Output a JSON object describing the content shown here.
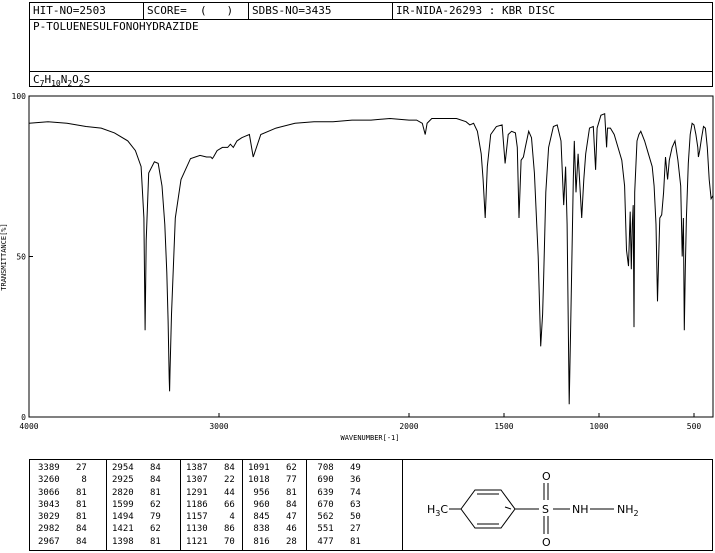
{
  "header": {
    "hit_no": "HIT-NO=2503",
    "score": "SCORE=  (   )",
    "sdbs_no": "SDBS-NO=3435",
    "ir_info": "IR-NIDA-26293 : KBR DISC",
    "compound_name": "P-TOLUENESULFONOHYDRAZIDE",
    "formula": {
      "C": "7",
      "H": "10",
      "N": "2",
      "O": "2",
      "S": ""
    }
  },
  "chart_data": {
    "type": "line",
    "xlabel": "WAVENUMBER[-1]",
    "ylabel": "TRANSMITTANCE[%]",
    "xlim": [
      4000,
      400
    ],
    "ylim": [
      0,
      100
    ],
    "x_ticks": [
      4000,
      3000,
      2000,
      1500,
      1000,
      500
    ],
    "y_ticks": [
      0,
      50,
      100
    ],
    "series": [
      {
        "x": [
          4000,
          3900,
          3800,
          3750,
          3700,
          3620,
          3550,
          3480,
          3440,
          3410,
          3395,
          3389,
          3383,
          3370,
          3340,
          3320,
          3300,
          3285,
          3275,
          3268,
          3262,
          3260,
          3258,
          3250,
          3230,
          3200,
          3150,
          3100,
          3066,
          3043,
          3035,
          3029,
          3010,
          2982,
          2967,
          2954,
          2940,
          2925,
          2905,
          2880,
          2860,
          2840,
          2820,
          2780,
          2700,
          2600,
          2500,
          2400,
          2300,
          2200,
          2100,
          2000,
          1960,
          1930,
          1915,
          1905,
          1880,
          1840,
          1800,
          1750,
          1700,
          1680,
          1660,
          1640,
          1620,
          1610,
          1599,
          1588,
          1570,
          1540,
          1510,
          1494,
          1478,
          1460,
          1440,
          1430,
          1421,
          1410,
          1398,
          1388,
          1370,
          1355,
          1340,
          1320,
          1307,
          1297,
          1291,
          1280,
          1265,
          1240,
          1220,
          1200,
          1186,
          1176,
          1168,
          1157,
          1148,
          1135,
          1130,
          1121,
          1110,
          1091,
          1080,
          1070,
          1050,
          1030,
          1018,
          1010,
          990,
          970,
          960,
          955,
          940,
          920,
          900,
          880,
          865,
          855,
          845,
          836,
          830,
          825,
          820,
          816,
          812,
          800,
          790,
          780,
          760,
          740,
          720,
          710,
          700,
          692,
          686,
          680,
          670,
          660,
          650,
          639,
          630,
          615,
          600,
          585,
          570,
          562,
          556,
          551,
          546,
          540,
          530,
          520,
          510,
          500,
          490,
          480,
          477,
          470,
          460,
          450,
          440,
          430,
          420,
          410,
          400
        ],
        "y": [
          91.5,
          92.0,
          91.5,
          91.0,
          90.5,
          90.0,
          88.5,
          86.0,
          83.0,
          78.0,
          62.0,
          27.0,
          55.0,
          76.0,
          79.5,
          79.0,
          72.0,
          60.0,
          45.0,
          30.0,
          12.0,
          8.0,
          14.0,
          32.0,
          62.0,
          74.0,
          80.5,
          81.5,
          81.0,
          81.0,
          80.5,
          81.0,
          83.0,
          84.0,
          84.0,
          84.0,
          85.0,
          84.0,
          86.0,
          87.0,
          87.5,
          88.0,
          81.0,
          88.0,
          90.0,
          91.5,
          92.0,
          92.0,
          92.5,
          92.5,
          93.0,
          92.5,
          92.5,
          91.5,
          88.0,
          91.5,
          93.0,
          93.0,
          93.0,
          93.0,
          92.0,
          91.0,
          91.5,
          89.0,
          82.0,
          74.0,
          62.0,
          78.0,
          88.0,
          90.5,
          91.0,
          79.0,
          88.0,
          89.0,
          88.5,
          84.0,
          62.0,
          80.0,
          81.0,
          84.0,
          89.0,
          87.0,
          76.0,
          50.0,
          22.0,
          32.0,
          44.0,
          70.0,
          84.0,
          90.5,
          91.0,
          86.0,
          66.0,
          78.0,
          60.0,
          4.0,
          32.0,
          74.0,
          86.0,
          70.0,
          82.0,
          62.0,
          74.0,
          82.0,
          90.0,
          90.5,
          77.0,
          90.0,
          94.0,
          94.5,
          84.0,
          90.0,
          90.0,
          88.0,
          84.0,
          80.0,
          72.0,
          52.0,
          47.0,
          64.0,
          46.0,
          60.0,
          66.0,
          28.0,
          70.0,
          86.0,
          88.0,
          89.0,
          86.0,
          82.0,
          78.0,
          72.0,
          60.0,
          36.0,
          50.0,
          62.0,
          63.0,
          70.0,
          81.0,
          74.0,
          80.0,
          84.0,
          86.0,
          80.0,
          72.0,
          50.0,
          62.0,
          27.0,
          46.0,
          62.0,
          79.0,
          88.0,
          91.5,
          91.0,
          88.0,
          84.0,
          81.0,
          83.0,
          87.0,
          90.5,
          90.0,
          84.0,
          74.0,
          68.0,
          69.0
        ]
      }
    ]
  },
  "peaks": [
    {
      "wn": "3389",
      "t": "27"
    },
    {
      "wn": "3260",
      "t": "8"
    },
    {
      "wn": "3066",
      "t": "81"
    },
    {
      "wn": "3043",
      "t": "81"
    },
    {
      "wn": "3029",
      "t": "81"
    },
    {
      "wn": "2982",
      "t": "84"
    },
    {
      "wn": "2967",
      "t": "84"
    },
    {
      "wn": "2954",
      "t": "84"
    },
    {
      "wn": "2925",
      "t": "84"
    },
    {
      "wn": "2820",
      "t": "81"
    },
    {
      "wn": "1599",
      "t": "62"
    },
    {
      "wn": "1494",
      "t": "79"
    },
    {
      "wn": "1421",
      "t": "62"
    },
    {
      "wn": "1398",
      "t": "81"
    },
    {
      "wn": "1387",
      "t": "84"
    },
    {
      "wn": "1307",
      "t": "22"
    },
    {
      "wn": "1291",
      "t": "44"
    },
    {
      "wn": "1186",
      "t": "66"
    },
    {
      "wn": "1157",
      "t": "4"
    },
    {
      "wn": "1130",
      "t": "86"
    },
    {
      "wn": "1121",
      "t": "70"
    },
    {
      "wn": "1091",
      "t": "62"
    },
    {
      "wn": "1018",
      "t": "77"
    },
    {
      "wn": "956",
      "t": "81"
    },
    {
      "wn": "960",
      "t": "84"
    },
    {
      "wn": "845",
      "t": "47"
    },
    {
      "wn": "838",
      "t": "46"
    },
    {
      "wn": "816",
      "t": "28"
    },
    {
      "wn": "708",
      "t": "49"
    },
    {
      "wn": "690",
      "t": "36"
    },
    {
      "wn": "639",
      "t": "74"
    },
    {
      "wn": "670",
      "t": "63"
    },
    {
      "wn": "562",
      "t": "50"
    },
    {
      "wn": "551",
      "t": "27"
    },
    {
      "wn": "477",
      "t": "81"
    }
  ],
  "structure": {
    "left_group": "H",
    "left_group_sub": "3",
    "left_group_tail": "C",
    "sulfur": "S",
    "oxygen": "O",
    "nh": "NH",
    "nh2": "NH",
    "nh2_sub": "2"
  }
}
